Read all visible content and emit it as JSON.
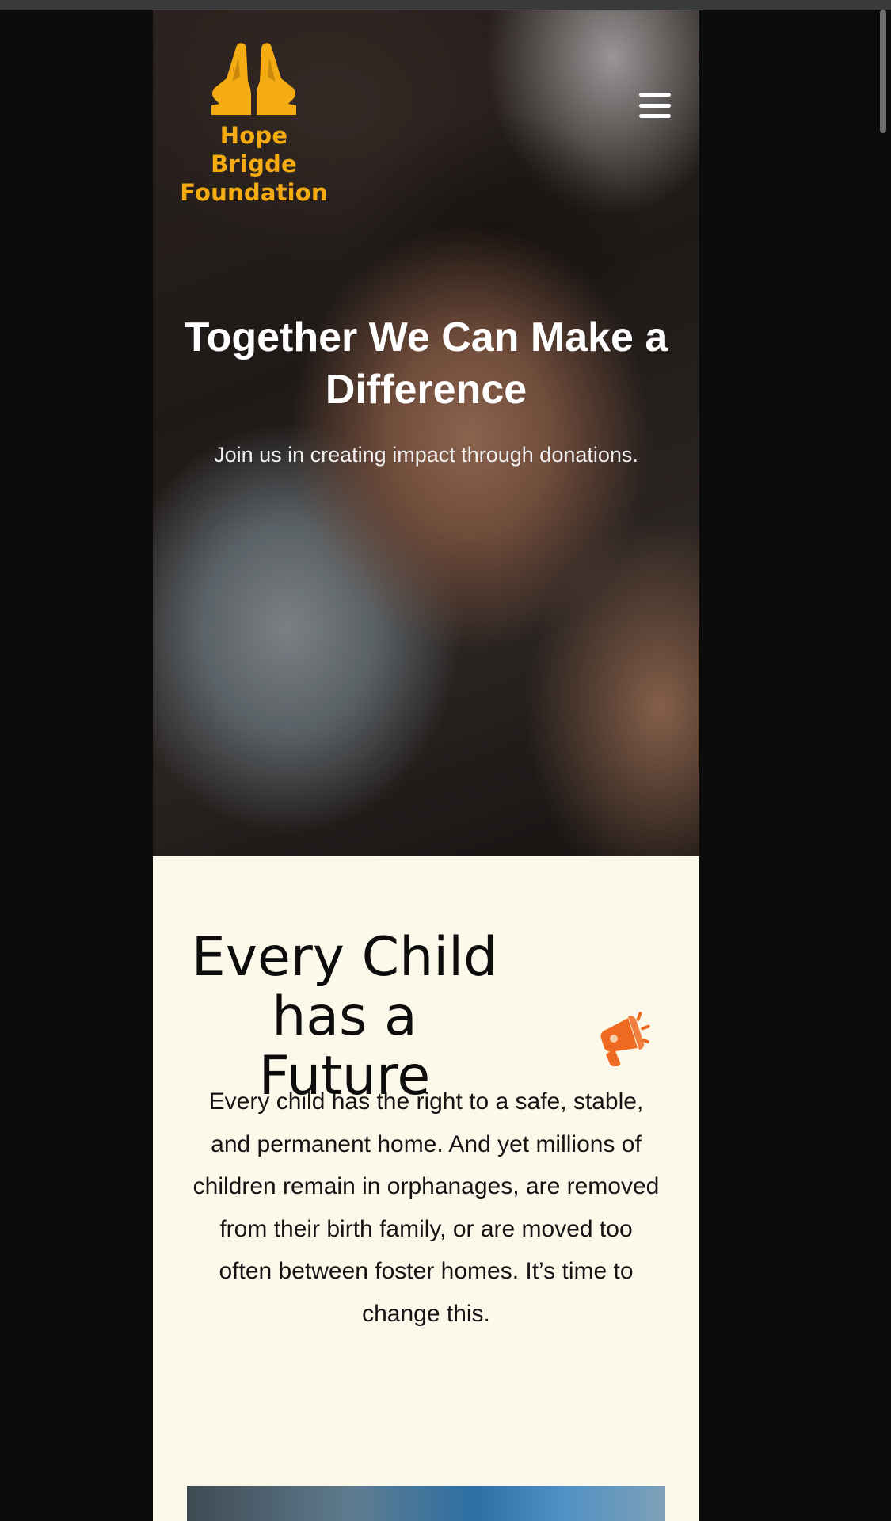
{
  "brand": {
    "name": "Hope Brigde Foundation",
    "name_line1": "Hope Brigde",
    "name_line2": "Foundation",
    "logo_icon": "praying-hands-icon",
    "accent_color": "#f5ab12"
  },
  "nav": {
    "menu_icon": "hamburger-menu-icon"
  },
  "hero": {
    "title": "Together We Can Make a Difference",
    "subtitle": "Join us in creating impact through donations."
  },
  "future": {
    "title": "Every Child has a Future",
    "icon": "megaphone-icon",
    "icon_color": "#ef6a21",
    "body": "Every child has the right to a safe, stable, and permanent home. And yet millions of children remain in orphanages, are removed from their birth family, or are moved too often between foster homes. It’s time to change this."
  }
}
